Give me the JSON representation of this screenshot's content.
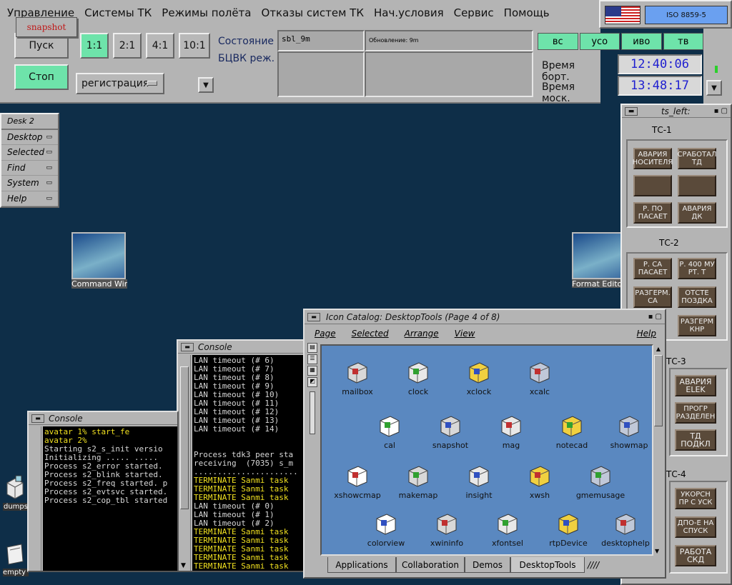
{
  "snapshot_label": "snapshot",
  "menu": [
    "Управление",
    "Системы ТК",
    "Режимы полёта",
    "Отказы систем ТК",
    "Нач.условия",
    "Сервис",
    "Помощь"
  ],
  "flag": {
    "code": "ISO 8859-5"
  },
  "controls": {
    "pusk": "Пуск",
    "stop": "Стоп",
    "speeds": [
      "1:1",
      "2:1",
      "4:1",
      "10:1"
    ],
    "mode": "регистрация",
    "state_label_1": "Состояние",
    "state_label_2": "БЦВК реж.",
    "field1": "sbl_9m",
    "field2": "Обновление: 9m",
    "indicators": [
      "вс",
      "усо",
      "иво",
      "тв"
    ],
    "time_board_label": "Время борт.",
    "time_board": "12:40:06",
    "time_msk_label": "Время моск.",
    "time_msk": "13:48:17"
  },
  "desk": {
    "title": "Desk 2",
    "items": [
      "Desktop",
      "Selected",
      "Find",
      "System",
      "Help"
    ]
  },
  "desktop_icons": {
    "cmd": "Command Win",
    "fmt": "Format Edito",
    "dumps": "dumps",
    "empty": "empty c"
  },
  "ts_left": {
    "title": "ts_left:",
    "groups": [
      {
        "name": "ТС-1",
        "buttons": [
          "АВАРИЯ НОСИТЕЛЯ",
          "СРАБОТАЛ ТД",
          "",
          "",
          "Р. ПО ПАСАЕТ",
          "АВАРИЯ ДК"
        ]
      },
      {
        "name": "ТС-2",
        "buttons": [
          "Р. СА ПАСАЕТ",
          "Р. 400 МУ РТ. Т",
          "РАЗГЕРМ. СА",
          "ОТСТЕ ПОЗДКА",
          "РАЗГЕРМ КНР"
        ]
      },
      {
        "name": "ТС-3",
        "buttons": [
          "АВАРИЯ ELEK",
          "ПРОГР РАЗДЕЛЕН",
          "ТД ПОДКЛ"
        ]
      },
      {
        "name": "ТС-4",
        "buttons": [
          "УКОРСН ПР С УСК",
          "ДПО-Е НА СПУСК",
          "РАБОТА СКД"
        ]
      }
    ]
  },
  "console1": {
    "title": "Console",
    "lines": [
      {
        "t": "LAN timeout (# 6)",
        "c": "w"
      },
      {
        "t": "LAN timeout (# 7)",
        "c": "w"
      },
      {
        "t": "LAN timeout (# 8)",
        "c": "w"
      },
      {
        "t": "LAN timeout (# 9)",
        "c": "w"
      },
      {
        "t": "LAN timeout (# 10)",
        "c": "w"
      },
      {
        "t": "LAN timeout (# 11)",
        "c": "w"
      },
      {
        "t": "LAN timeout (# 12)",
        "c": "w"
      },
      {
        "t": "LAN timeout (# 13)",
        "c": "w"
      },
      {
        "t": "LAN timeout (# 14)",
        "c": "w"
      },
      {
        "t": "",
        "c": "w"
      },
      {
        "t": "",
        "c": "w"
      },
      {
        "t": "Process tdk3 peer sta",
        "c": "w"
      },
      {
        "t": "receiving  (7035) s_m",
        "c": "w"
      },
      {
        "t": "......................",
        "c": "w"
      },
      {
        "t": "TERMINATE Sanmi task",
        "c": "y"
      },
      {
        "t": "TERMINATE Sanmi task",
        "c": "y"
      },
      {
        "t": "TERMINATE Sanmi task",
        "c": "y"
      },
      {
        "t": "LAN timeout (# 0)",
        "c": "w"
      },
      {
        "t": "LAN timeout (# 1)",
        "c": "w"
      },
      {
        "t": "LAN timeout (# 2)",
        "c": "w"
      },
      {
        "t": "TERMINATE Sanmi task",
        "c": "y"
      },
      {
        "t": "TERMINATE Sanmi task",
        "c": "y"
      },
      {
        "t": "TERMINATE Sanmi task",
        "c": "y"
      },
      {
        "t": "TERMINATE Sanmi task",
        "c": "y"
      },
      {
        "t": "TERMINATE Sanmi task",
        "c": "y"
      }
    ]
  },
  "console2": {
    "title": "Console",
    "lines": [
      {
        "t": "avatar 1% start_fe",
        "c": "y"
      },
      {
        "t": "avatar 2%",
        "c": "y"
      },
      {
        "t": "Starting s2_s_init versio",
        "c": "w"
      },
      {
        "t": "Initializing ..... .....",
        "c": "w"
      },
      {
        "t": "Process s2_error started.",
        "c": "w"
      },
      {
        "t": "Process s2_blink started.",
        "c": "w"
      },
      {
        "t": "Process s2_freq started. p",
        "c": "w"
      },
      {
        "t": "Process s2_evtsvc started.",
        "c": "w"
      },
      {
        "t": "Process s2_cop_tbl started",
        "c": "w"
      }
    ]
  },
  "catalog": {
    "title": "Icon Catalog: DesktopTools (Page 4 of 8)",
    "menu": [
      "Page",
      "Selected",
      "Arrange",
      "View",
      "Help"
    ],
    "icons": [
      "mailbox",
      "clock",
      "xclock",
      "xcalc",
      "cal",
      "snapshot",
      "mag",
      "notecad",
      "showmap",
      "xshowcmap",
      "makemap",
      "insight",
      "xwsh",
      "gmemusage",
      "colorview",
      "xwininfo",
      "xfontsel",
      "rtpDevice",
      "desktophelp"
    ],
    "tabs": [
      "Applications",
      "Collaboration",
      "Demos",
      "DesktopTools"
    ]
  }
}
